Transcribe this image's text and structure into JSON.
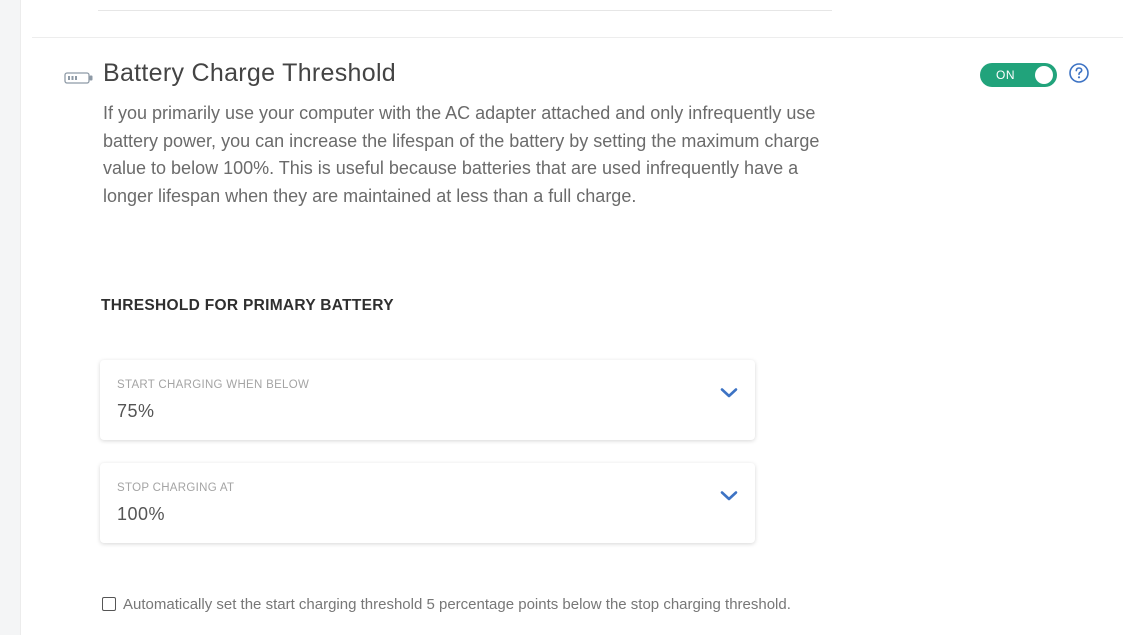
{
  "section": {
    "title": "Battery Charge Threshold",
    "icon": "battery-icon",
    "toggle": {
      "label": "ON",
      "state": "on",
      "color": "#21a37b"
    },
    "help_icon": "question-circle-icon",
    "description": "If you primarily use your computer with the AC adapter attached and only infrequently use battery power, you can increase the lifespan of the battery by setting the maximum charge value to below 100%. This is useful because batteries that are used infrequently have a longer lifespan when they are maintained at less than a full charge."
  },
  "threshold": {
    "heading": "THRESHOLD FOR PRIMARY BATTERY",
    "start": {
      "label": "START CHARGING WHEN BELOW",
      "value": "75%"
    },
    "stop": {
      "label": "STOP CHARGING AT",
      "value": "100%"
    },
    "accent_color": "#3d73c4"
  },
  "auto_option": {
    "checked": false,
    "label": "Automatically set the start charging threshold 5 percentage points below the stop charging threshold."
  }
}
